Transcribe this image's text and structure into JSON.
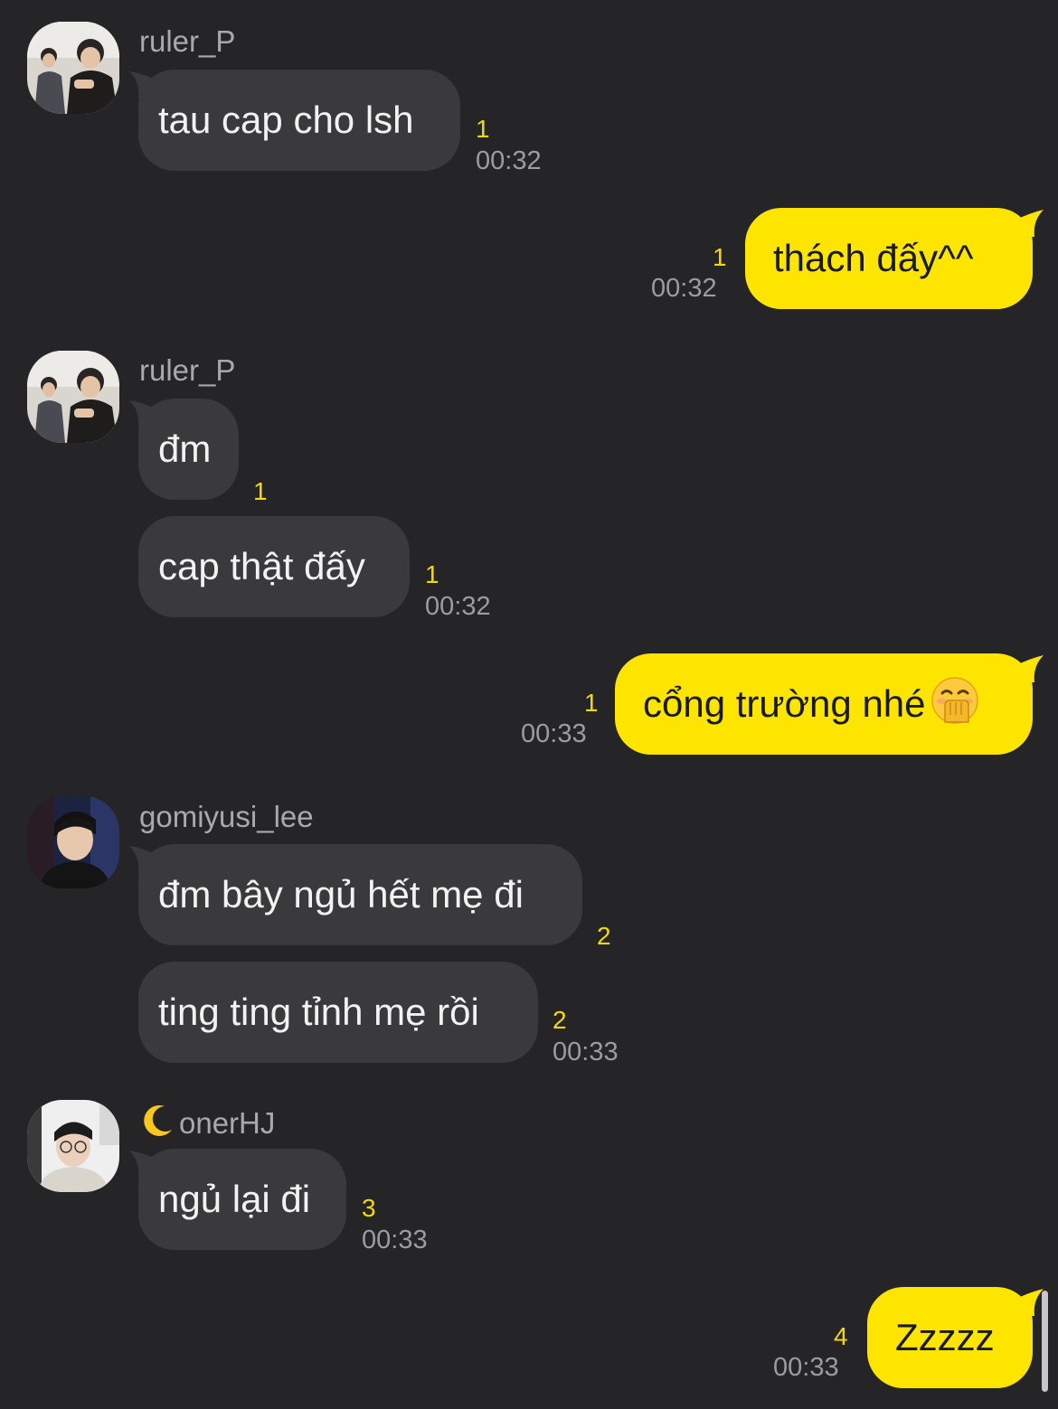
{
  "colors": {
    "background": "#252527",
    "incoming_bubble": "#3a3a3c",
    "outgoing_bubble": "#fee500",
    "unread_count": "#f5d900",
    "timestamp": "#9c9c9e"
  },
  "messages": [
    {
      "sender": "ruler_P",
      "text": "tau cap cho lsh",
      "unread": "1",
      "time": "00:32"
    },
    {
      "text": "thách đấy^^",
      "unread": "1",
      "time": "00:32"
    },
    {
      "sender": "ruler_P",
      "text": "đm",
      "unread": "1"
    },
    {
      "text": "cap thật đấy",
      "unread": "1",
      "time": "00:32"
    },
    {
      "text": "cổng trường nhé",
      "emoji": "hand-over-mouth-emoji-icon",
      "unread": "1",
      "time": "00:33"
    },
    {
      "sender": "gomiyusi_lee",
      "text": "đm bây ngủ hết mẹ đi",
      "unread": "2"
    },
    {
      "text": "ting ting tỉnh mẹ rồi",
      "unread": "2",
      "time": "00:33"
    },
    {
      "sender": "onerHJ",
      "sender_icon": "crescent-moon-icon",
      "text": "ngủ lại đi",
      "unread": "3",
      "time": "00:33"
    },
    {
      "text": "Zzzzz",
      "unread": "4",
      "time": "00:33"
    }
  ]
}
